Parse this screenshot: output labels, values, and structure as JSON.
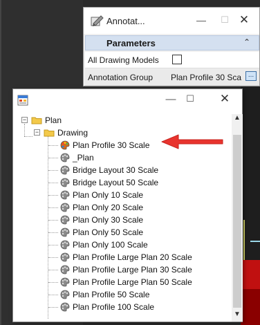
{
  "annotation_window": {
    "title": "Annotat...",
    "minimize": "—",
    "maximize": "☐",
    "close": "✕",
    "section_label": "Parameters",
    "section_chevron": "⌃",
    "rows": [
      {
        "key": "All Drawing Models",
        "value": ""
      },
      {
        "key": "Annotation Group",
        "value": "Plan Profile 30 Sca"
      }
    ],
    "browse_label": "..."
  },
  "tree_window": {
    "minimize": "—",
    "maximize": "☐",
    "close": "✕",
    "root": {
      "label": "Plan",
      "expander": "−"
    },
    "folder": {
      "label": "Drawing",
      "expander": "−"
    },
    "items": [
      "Plan Profile 30 Scale",
      "_Plan",
      "Bridge Layout 30 Scale",
      "Bridge Layout 50 Scale",
      "Plan Only 10 Scale",
      "Plan Only 20 Scale",
      "Plan Only 30 Scale",
      "Plan Only 50 Scale",
      "Plan Only 100 Scale",
      "Plan Profile Large Plan 20 Scale",
      "Plan Profile Large Plan 30 Scale",
      "Plan Profile Large Plan 50 Scale",
      "Plan Profile 50 Scale",
      "Plan Profile 100 Scale"
    ],
    "selected_index": 0,
    "scroll_up": "▲",
    "scroll_down": "▼"
  },
  "colors": {
    "arrow": "#e8342e",
    "selected_palette": "#d2691e",
    "palette": "#8a8a8a",
    "folder": "#f3c94a"
  }
}
